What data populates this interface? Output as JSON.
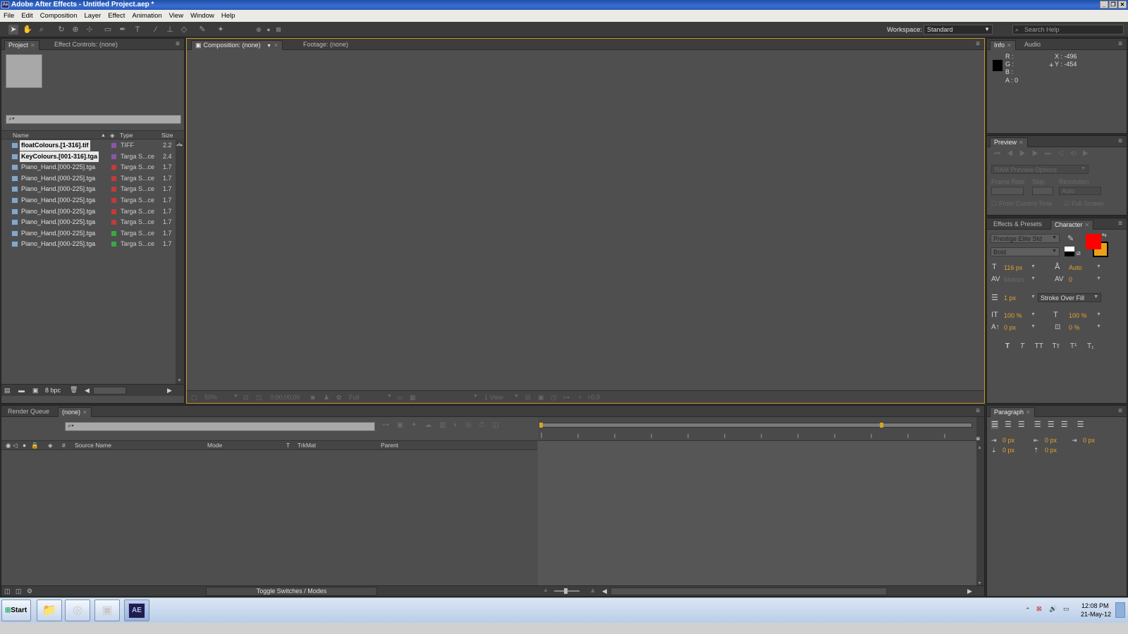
{
  "window": {
    "title": "Adobe After Effects - Untitled Project.aep *",
    "app_icon": "Ae",
    "controls": [
      "_",
      "❐",
      "✕"
    ]
  },
  "menu": [
    "File",
    "Edit",
    "Composition",
    "Layer",
    "Effect",
    "Animation",
    "View",
    "Window",
    "Help"
  ],
  "toolbar": {
    "tools": [
      "selection-tool",
      "hand-tool",
      "zoom-tool",
      "rotation-tool",
      "camera-orbit-tool",
      "pan-behind-tool",
      "mask-tool",
      "pen-tool",
      "type-tool",
      "brush-tool",
      "clone-stamp-tool",
      "eraser-tool",
      "roto-brush-tool",
      "puppet-tool"
    ],
    "workspace_label": "Workspace:",
    "workspace_value": "Standard",
    "search_placeholder": "Search Help"
  },
  "project_panel": {
    "tabs": [
      {
        "label": "Project",
        "active": true
      },
      {
        "label": "Effect Controls: (none)",
        "active": false
      }
    ],
    "search_placeholder": "",
    "columns": [
      "Name",
      "Type",
      "Size"
    ],
    "rows": [
      {
        "name": "floatColours.[1-316].tif",
        "type": "TIFF",
        "size": "2.2",
        "label_color": "#8d55a6",
        "selected": true
      },
      {
        "name": "KeyColours.[001-316].tga",
        "type": "Targa S...ce",
        "size": "2.4",
        "label_color": "#8d55a6",
        "selected": true
      },
      {
        "name": "Piano_Hand.[000-225].tga",
        "type": "Targa S...ce",
        "size": "1.7",
        "label_color": "#c23b3b",
        "selected": false
      },
      {
        "name": "Piano_Hand.[000-225].tga",
        "type": "Targa S...ce",
        "size": "1.7",
        "label_color": "#c23b3b",
        "selected": false
      },
      {
        "name": "Piano_Hand.[000-225].tga",
        "type": "Targa S...ce",
        "size": "1.7",
        "label_color": "#c23b3b",
        "selected": false
      },
      {
        "name": "Piano_Hand.[000-225].tga",
        "type": "Targa S...ce",
        "size": "1.7",
        "label_color": "#c23b3b",
        "selected": false
      },
      {
        "name": "Piano_Hand.[000-225].tga",
        "type": "Targa S...ce",
        "size": "1.7",
        "label_color": "#c23b3b",
        "selected": false
      },
      {
        "name": "Piano_Hand.[000-225].tga",
        "type": "Targa S...ce",
        "size": "1.7",
        "label_color": "#c23b3b",
        "selected": false
      },
      {
        "name": "Piano_Hand.[000-225].tga",
        "type": "Targa S...ce",
        "size": "1.7",
        "label_color": "#3aa845",
        "selected": false
      },
      {
        "name": "Piano_Hand.[000-225].tga",
        "type": "Targa S...ce",
        "size": "1.7",
        "label_color": "#3aa845",
        "selected": false
      }
    ],
    "bpc": "8 bpc"
  },
  "viewer": {
    "tabs": [
      {
        "label": "Composition: (none)",
        "active": true
      },
      {
        "label": "Footage: (none)",
        "active": false
      }
    ],
    "zoom": "50%",
    "timecode": "0;00;00;00",
    "resolution": "Full",
    "views": "1 View",
    "exposure": "+0.0"
  },
  "info_panel": {
    "tabs": [
      {
        "label": "Info",
        "active": true
      },
      {
        "label": "Audio",
        "active": false
      }
    ],
    "r": "R :",
    "g": "G :",
    "b": "B :",
    "a": "A : 0",
    "x": "X : -496",
    "y": "Y : -454"
  },
  "preview_panel": {
    "tab": "Preview",
    "ram_options": "RAM Preview Options",
    "frame_rate_label": "Frame Rate",
    "skip_label": "Skip",
    "resolution_label": "Resolution",
    "resolution_value": "Auto",
    "from_current": "From Current Time",
    "full_screen": "Full Screen"
  },
  "character_panel": {
    "tabs": [
      {
        "label": "Effects & Presets",
        "active": false
      },
      {
        "label": "Character",
        "active": true
      }
    ],
    "font": "Prestige Elite Std",
    "style": "Bold",
    "size": "116 px",
    "leading": "Auto",
    "kerning": "Metrics",
    "tracking": "0",
    "stroke_width": "1 px",
    "stroke_mode": "Stroke Over Fill",
    "vscale": "100 %",
    "hscale": "100 %",
    "baseline": "0 px",
    "tsume": "0 %",
    "fill_color": "#ff0000",
    "stroke_color": "#e8a21a",
    "styles": [
      "T",
      "T",
      "TT",
      "Tт",
      "T¹",
      "T₁"
    ]
  },
  "paragraph_panel": {
    "tab": "Paragraph",
    "indent_left": "0 px",
    "indent_first": "0 px",
    "indent_right": "0 px",
    "space_before": "0 px",
    "space_after": "0 px"
  },
  "timeline": {
    "tabs": [
      {
        "label": "Render Queue",
        "active": false
      },
      {
        "label": "(none)",
        "active": true
      }
    ],
    "columns": [
      "#",
      "Source Name",
      "Mode",
      "T",
      "TrkMat",
      "Parent"
    ],
    "toggle_label": "Toggle Switches / Modes"
  },
  "taskbar": {
    "start": "Start",
    "time": "12:08 PM",
    "date": "21-May-12",
    "ae_button": "AE"
  }
}
